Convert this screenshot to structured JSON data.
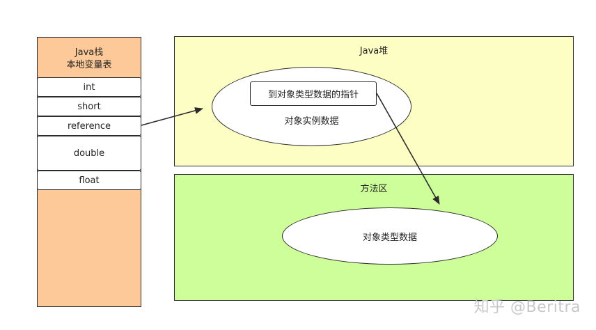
{
  "java_stack": {
    "title_line1": "Java栈",
    "title_line2": "本地变量表",
    "slots": [
      "int",
      "short",
      "reference",
      "double",
      "float"
    ]
  },
  "java_heap": {
    "title": "Java堆",
    "pointer_label": "到对象类型数据的指针",
    "instance_data_label": "对象实例数据"
  },
  "method_area": {
    "title": "方法区",
    "type_data_label": "对象类型数据"
  },
  "watermark": "知乎 @Beritra",
  "colors": {
    "stack": "#fec999",
    "heap": "#fdfec4",
    "method_area": "#cdfe9a"
  }
}
